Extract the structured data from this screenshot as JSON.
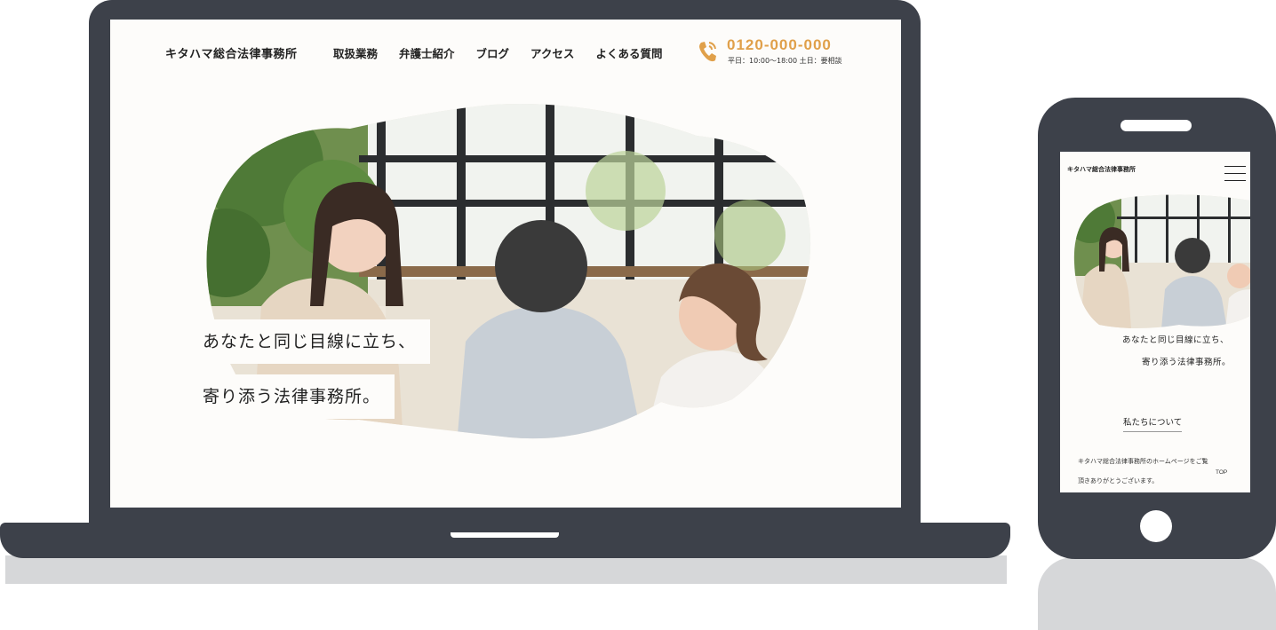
{
  "laptop": {
    "header": {
      "site_title": "キタハマ総合法律事務所",
      "nav": [
        {
          "label": "取扱業務"
        },
        {
          "label": "弁護士紹介"
        },
        {
          "label": "ブログ"
        },
        {
          "label": "アクセス"
        },
        {
          "label": "よくある質問"
        }
      ],
      "phone_icon": "phone-icon",
      "tel_number": "0120-000-000",
      "tel_hours": "平日：10:00〜18:00 土日：要相談"
    },
    "hero": {
      "caption_line1": "あなたと同じ目線に立ち、",
      "caption_line2": "寄り添う法律事務所。"
    }
  },
  "phone": {
    "site_title": "キタハマ総合法律事務所",
    "menu_icon": "hamburger-menu-icon",
    "hero": {
      "caption_line1": "あなたと同じ目線に立ち、",
      "caption_line2": "寄り添う法律事務所。"
    },
    "about_heading": "私たちについて",
    "about_text_line1": "キタハマ総合法律事務所のホームページをご覧",
    "about_text_line2": "頂きありがとうございます。",
    "top_link": "TOP"
  },
  "colors": {
    "device": "#3d414a",
    "accent": "#e0a04a",
    "page_bg": "#fdfcfa",
    "shadow": "#d6d7d9"
  }
}
